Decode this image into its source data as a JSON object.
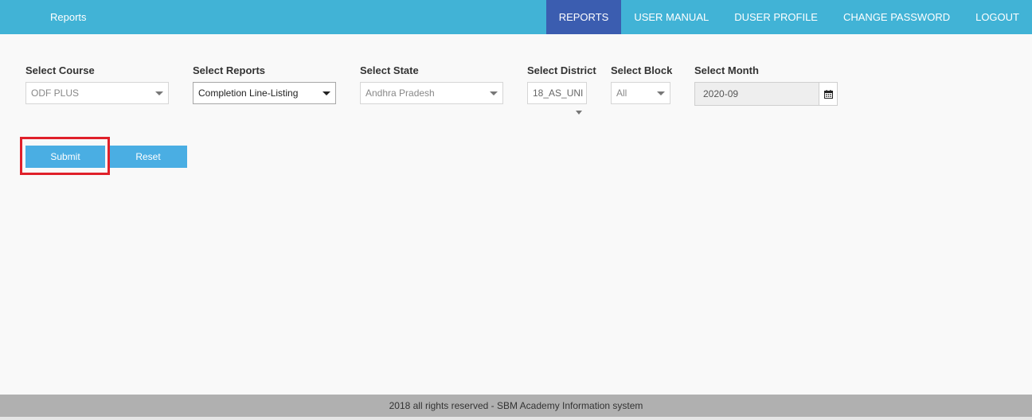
{
  "app": {
    "title": "Reports"
  },
  "nav": {
    "items": [
      {
        "label": "REPORTS",
        "active": true
      },
      {
        "label": "USER MANUAL"
      },
      {
        "label": "DUSER PROFILE"
      },
      {
        "label": "CHANGE PASSWORD"
      },
      {
        "label": "LOGOUT"
      }
    ]
  },
  "filters": {
    "course": {
      "label": "Select Course",
      "value": "ODF PLUS"
    },
    "reports": {
      "label": "Select Reports",
      "value": "Completion Line-Listing"
    },
    "state": {
      "label": "Select State",
      "value": "Andhra Pradesh"
    },
    "district": {
      "label": "Select District",
      "value": "18_AS_UNI"
    },
    "block": {
      "label": "Select Block",
      "value": "All"
    },
    "month": {
      "label": "Select Month",
      "value": "2020-09"
    }
  },
  "actions": {
    "submit_label": "Submit",
    "reset_label": "Reset"
  },
  "footer": {
    "text": "2018 all rights reserved - SBM Academy Information system"
  },
  "colors": {
    "topbar": "#41b3d6",
    "active_nav": "#3b5db0",
    "button": "#4aaee3",
    "highlight": "#e0202a",
    "footer": "#b0b0b0"
  },
  "icons": {
    "calendar": "calendar-icon",
    "dropdown": "caret-down-icon"
  }
}
